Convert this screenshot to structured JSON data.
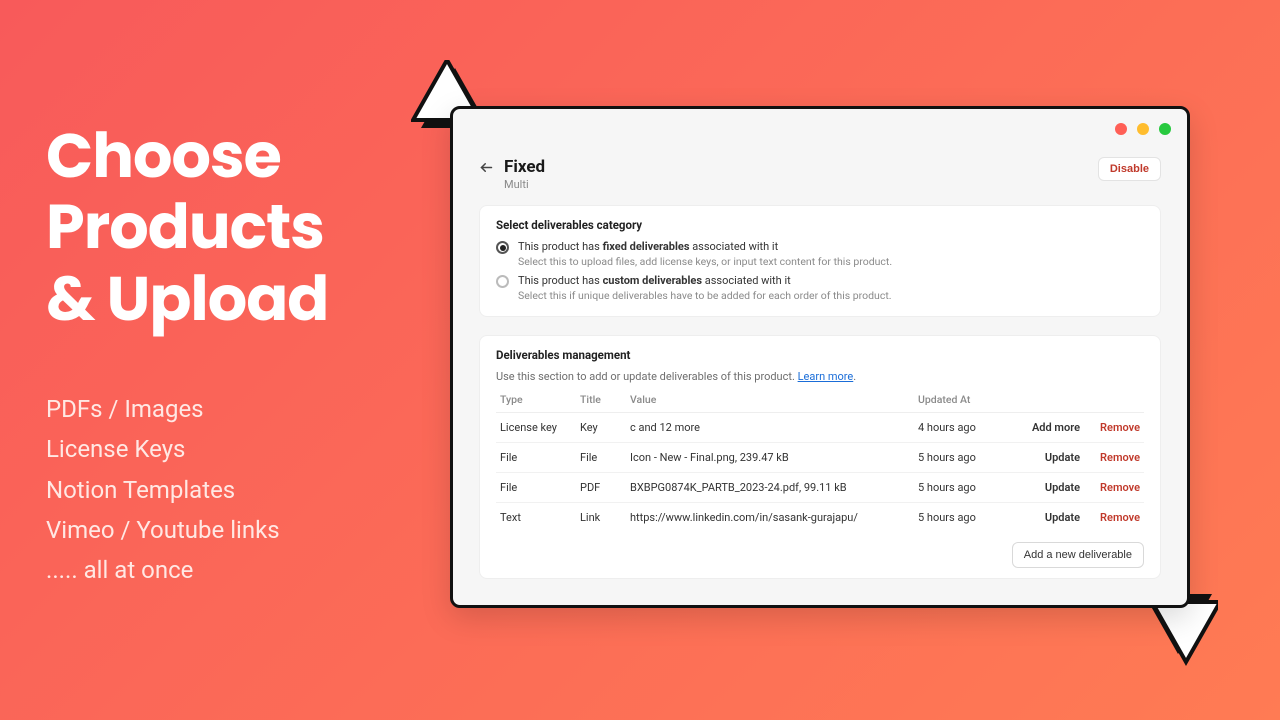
{
  "marketing": {
    "headline_l1": "Choose",
    "headline_l2": "Products",
    "headline_l3": "& Upload",
    "bullets": [
      "PDFs / Images",
      "License Keys",
      "Notion Templates",
      "Vimeo / Youtube links",
      "..... all at once"
    ]
  },
  "window": {
    "traffic_colors": {
      "red": "#ff5f56",
      "yellow": "#ffbd2e",
      "green": "#27c93f"
    }
  },
  "page": {
    "title": "Fixed",
    "subtitle": "Multi",
    "disable_label": "Disable"
  },
  "category": {
    "heading": "Select deliverables category",
    "options": [
      {
        "label_pre": "This product has ",
        "label_bold": "fixed deliverables",
        "label_post": " associated with it",
        "help": "Select this to upload files, add license keys, or input text content for this product.",
        "checked": true
      },
      {
        "label_pre": "This product has ",
        "label_bold": "custom deliverables",
        "label_post": " associated with it",
        "help": "Select this if unique deliverables have to be added for each order of this product.",
        "checked": false
      }
    ]
  },
  "management": {
    "heading": "Deliverables management",
    "description_pre": "Use this section to add or update deliverables of this product. ",
    "learn_more": "Learn more",
    "description_post": ".",
    "columns": {
      "type": "Type",
      "title": "Title",
      "value": "Value",
      "updated": "Updated At"
    },
    "rows": [
      {
        "type": "License key",
        "title": "Key",
        "value": "c and 12 more",
        "updated": "4 hours ago",
        "action": "Add more"
      },
      {
        "type": "File",
        "title": "File",
        "value": "Icon - New - Final.png, 239.47 kB",
        "updated": "5 hours ago",
        "action": "Update"
      },
      {
        "type": "File",
        "title": "PDF",
        "value": "BXBPG0874K_PARTB_2023-24.pdf, 99.11 kB",
        "updated": "5 hours ago",
        "action": "Update"
      },
      {
        "type": "Text",
        "title": "Link",
        "value": "https://www.linkedin.com/in/sasank-gurajapu/",
        "updated": "5 hours ago",
        "action": "Update"
      }
    ],
    "remove_label": "Remove",
    "add_new_label": "Add a new deliverable"
  }
}
